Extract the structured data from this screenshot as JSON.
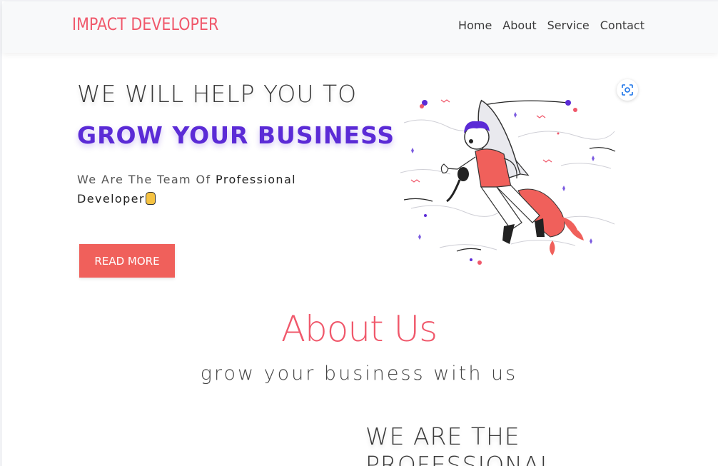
{
  "navbar": {
    "brand": "IMPACT DEVELOPER",
    "links": [
      "Home",
      "About",
      "Service",
      "Contact"
    ]
  },
  "hero": {
    "line1": "WE WILL HELP YOU TO",
    "line2": "GROW YOUR BUSINESS",
    "subtitle_prefix": "We Are The Team Of ",
    "subtitle_em": "Professional Developer",
    "button": "READ MORE",
    "illustration": "rocket-boy-with-cat-illustration",
    "lens_icon": "google-lens-icon"
  },
  "about": {
    "title": "About Us",
    "subtitle": "grow your business with us",
    "section_heading": "WE ARE THE PROFESSIONAL"
  },
  "colors": {
    "brand": "#f0586b",
    "accent_purple": "#5b2bd6",
    "button": "#f0605b"
  }
}
